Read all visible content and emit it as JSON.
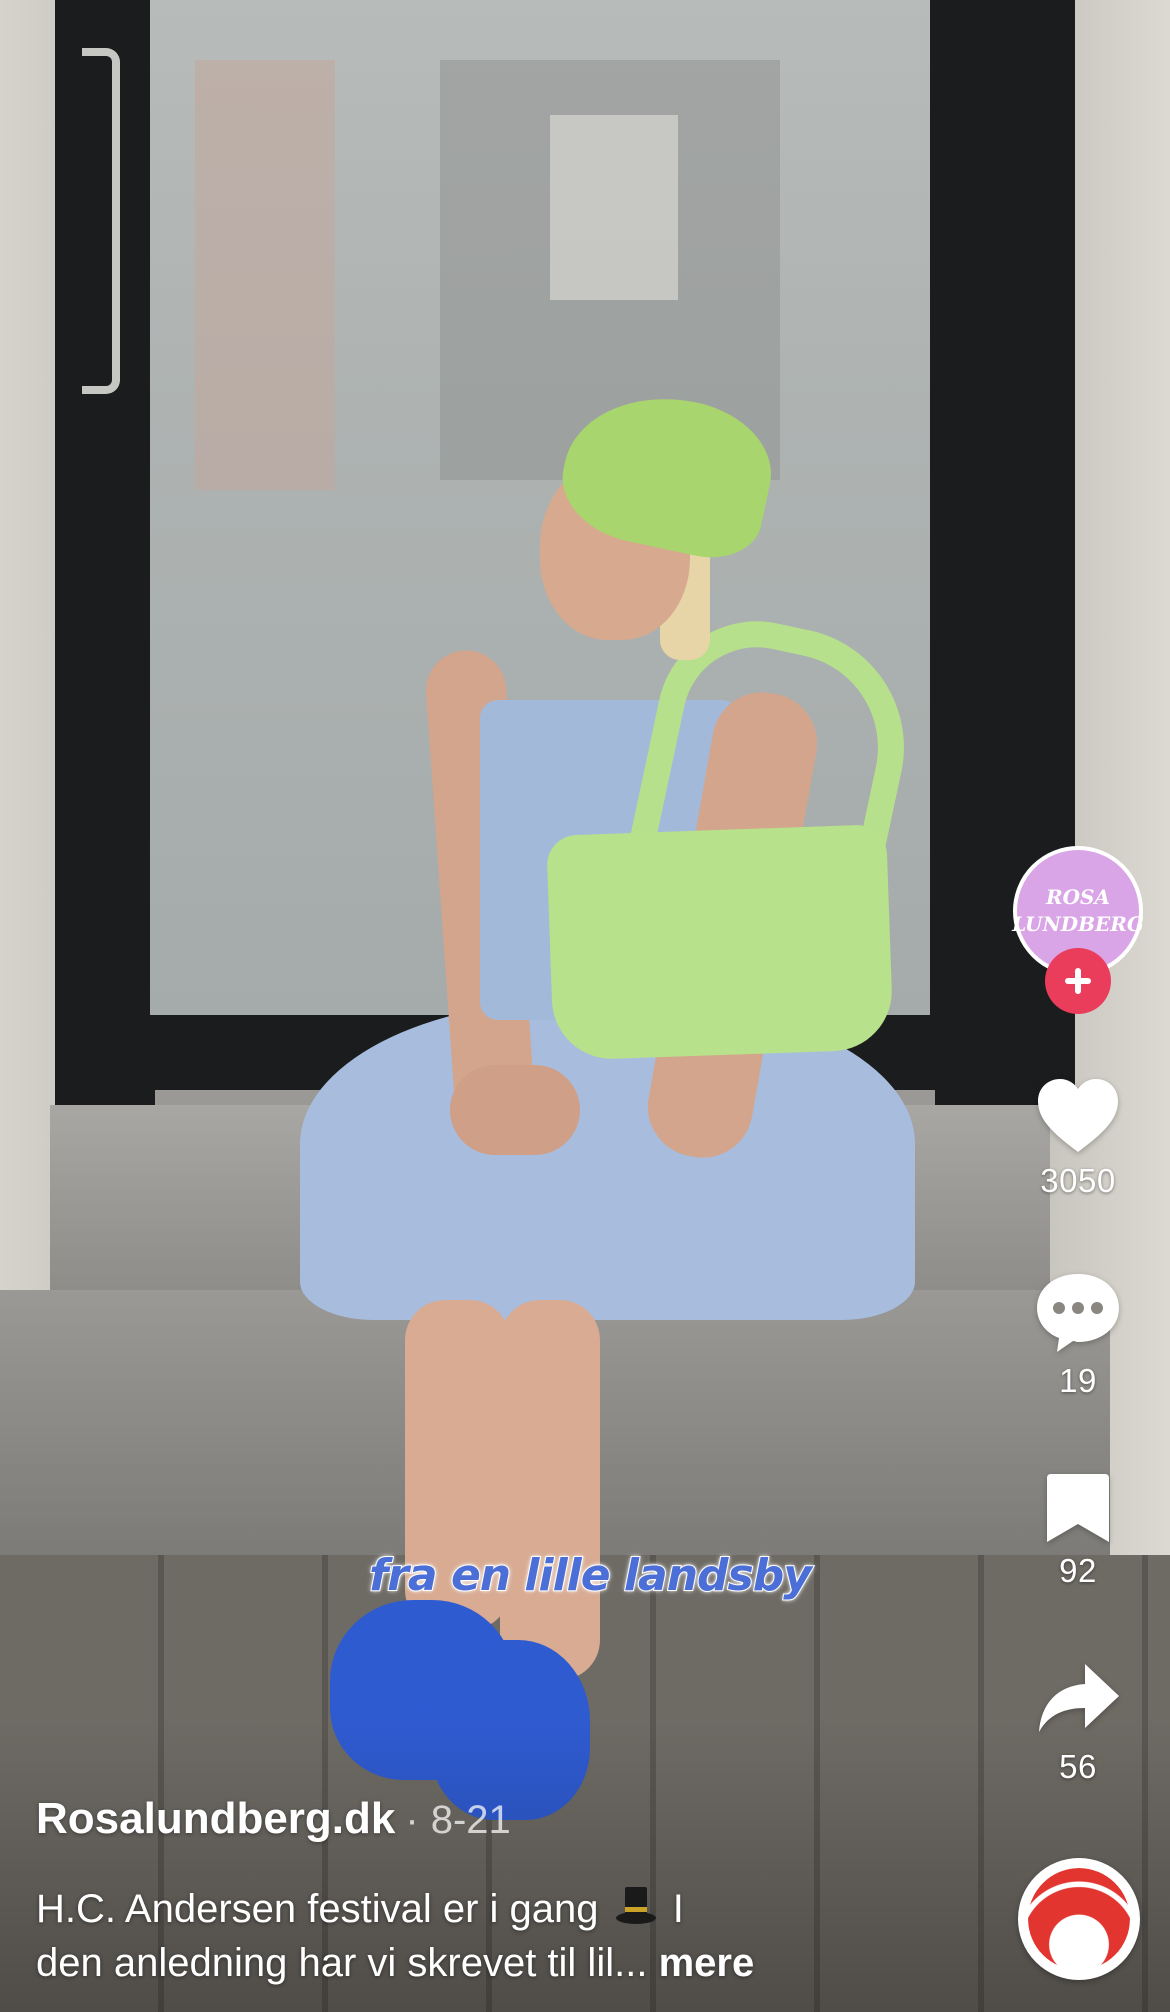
{
  "video": {
    "caption_sticker": "fra en lille landsby"
  },
  "creator": {
    "avatar_text_line1": "ROSA",
    "avatar_text_line2": "LUNDBERG",
    "avatar_color": "#d9a5e6",
    "follow_icon": "plus-icon"
  },
  "actions": {
    "likes": "3050",
    "comments": "19",
    "saves": "92",
    "shares": "56"
  },
  "post": {
    "username": "Rosalundberg.dk",
    "separator": "·",
    "time": "8-21",
    "description_line1": "H.C. Andersen festival er i gang",
    "description_emoji": "top-hat-emoji",
    "description_line1_tail": "I",
    "description_line2": "den anledning har vi skrevet til lil...",
    "more_label": "mere"
  },
  "colors": {
    "follow_button": "#ea3d5c",
    "caption_text": "#4b6fd6",
    "music_disc": "#e2352f"
  }
}
